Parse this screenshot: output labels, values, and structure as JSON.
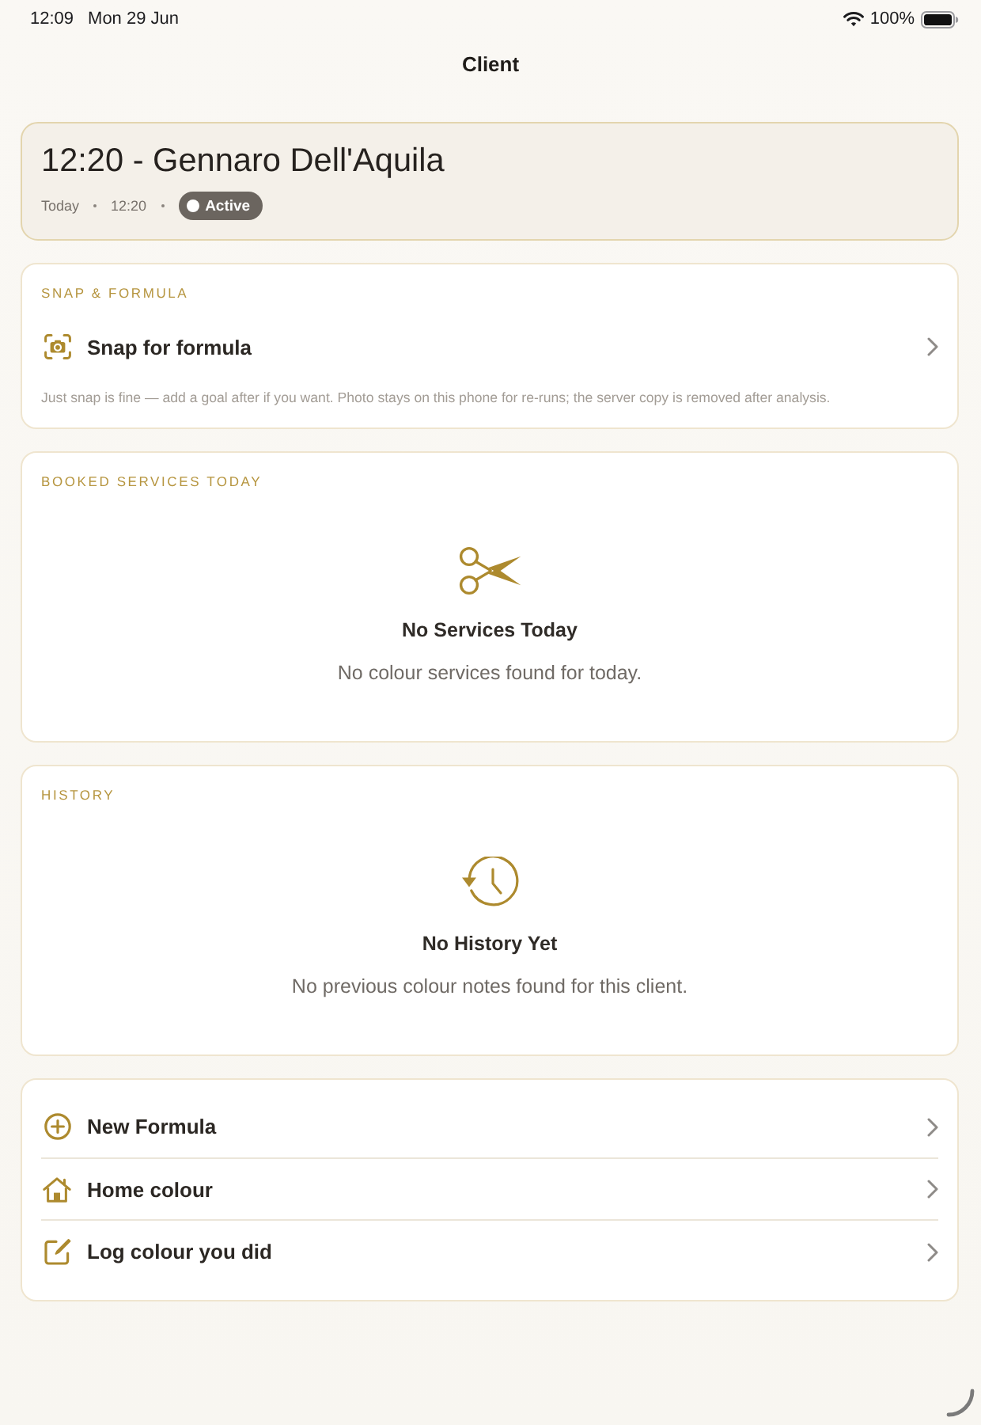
{
  "status_bar": {
    "time": "12:09",
    "date": "Mon 29 Jun",
    "battery": "100%"
  },
  "nav": {
    "title": "Client"
  },
  "appointment": {
    "title": "12:20 - Gennaro Dell'Aquila",
    "day": "Today",
    "time": "12:20",
    "status": "Active"
  },
  "sections": [
    {
      "kind": "snap",
      "heading": "SNAP & FORMULA",
      "action": "Snap for formula",
      "note": "Just snap is fine — add a goal after if you want. Photo stays on this phone for re-runs; the server copy is removed after analysis."
    },
    {
      "kind": "services",
      "heading": "BOOKED SERVICES TODAY",
      "empty_title": "No Services Today",
      "empty_message": "No colour services found for today."
    },
    {
      "kind": "history",
      "heading": "HISTORY",
      "empty_title": "No History Yet",
      "empty_message": "No previous colour notes found for this client."
    }
  ],
  "actions": [
    {
      "kind": "new",
      "label": "New Formula"
    },
    {
      "kind": "home",
      "label": "Home colour"
    },
    {
      "kind": "log",
      "label": "Log colour you did"
    }
  ]
}
